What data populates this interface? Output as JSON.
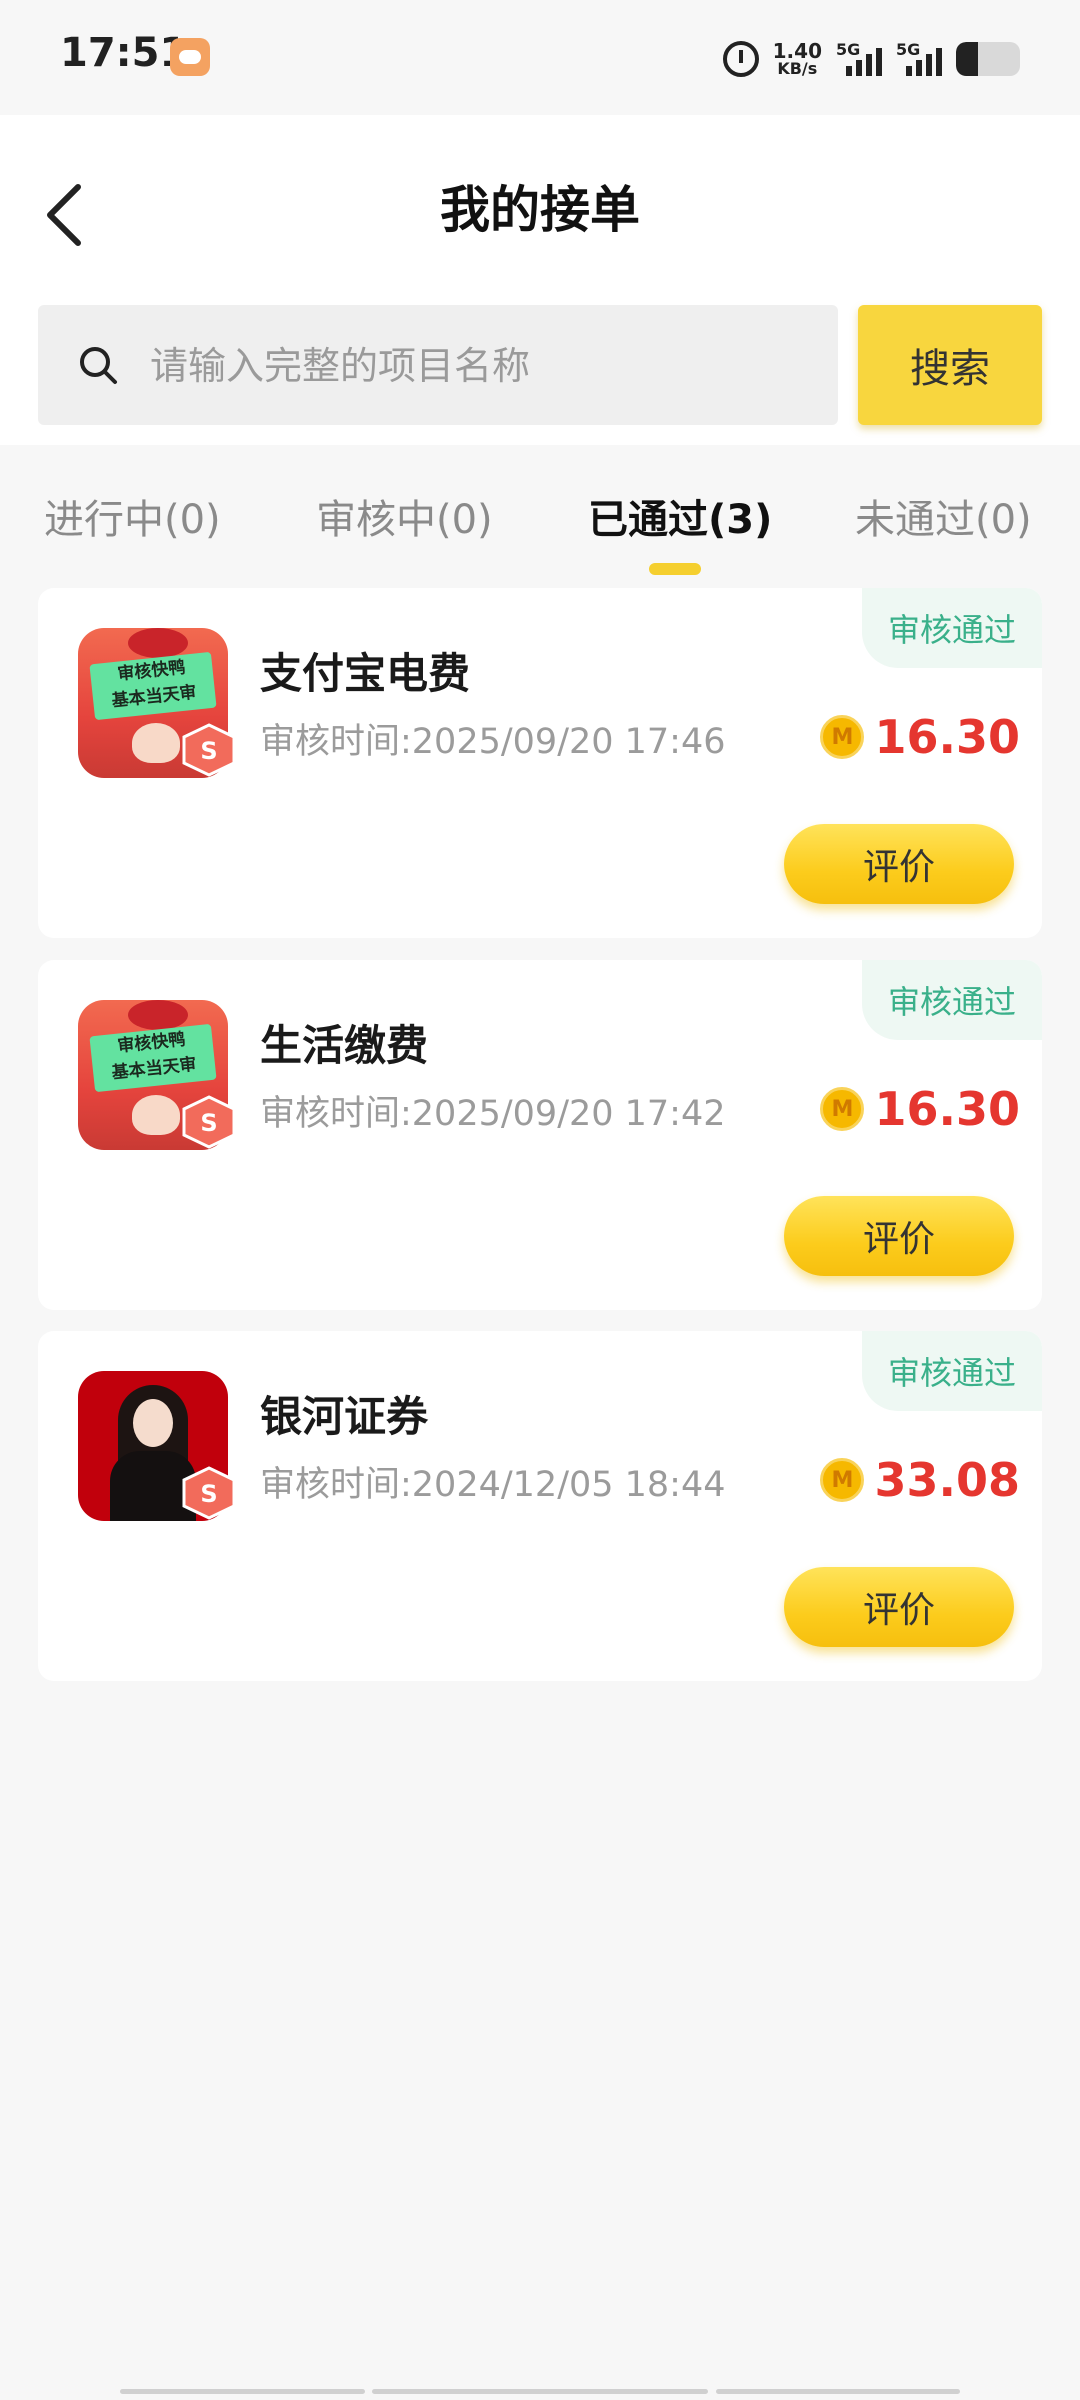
{
  "status_bar": {
    "time": "17:51",
    "net_speed_value": "1.40",
    "net_speed_unit": "KB/s",
    "signal_1": "5G",
    "signal_2": "5G",
    "battery_level": 0.35
  },
  "header": {
    "title": "我的接单",
    "back_icon": "chevron-left-icon"
  },
  "search": {
    "placeholder": "请输入完整的项目名称",
    "value": "",
    "button_label": "搜索",
    "accent": "#f8d63e"
  },
  "tabs": [
    {
      "label": "进行中(0)",
      "active": false
    },
    {
      "label": "审核中(0)",
      "active": false
    },
    {
      "label": "已通过(3)",
      "active": true
    },
    {
      "label": "未通过(0)",
      "active": false
    }
  ],
  "orders": [
    {
      "title": "支付宝电费",
      "time": "审核时间:2025/09/20 17:46",
      "status": "审核通过",
      "coin_symbol": "M",
      "amount": "16.30",
      "review_label": "评价",
      "thumb_text_1": "审核快鸭",
      "thumb_text_2": "基本当天审"
    },
    {
      "title": "生活缴费",
      "time": "审核时间:2025/09/20 17:42",
      "status": "审核通过",
      "coin_symbol": "M",
      "amount": "16.30",
      "review_label": "评价",
      "thumb_text_1": "审核快鸭",
      "thumb_text_2": "基本当天审"
    },
    {
      "title": "银河证券",
      "time": "审核时间:2024/12/05 18:44",
      "status": "审核通过",
      "coin_symbol": "M",
      "amount": "33.08",
      "review_label": "评价"
    }
  ],
  "colors": {
    "amount": "#e5362f",
    "status_text": "#3ab08a",
    "review_button": "#fccc1c",
    "tab_indicator": "#f5cf2f"
  }
}
